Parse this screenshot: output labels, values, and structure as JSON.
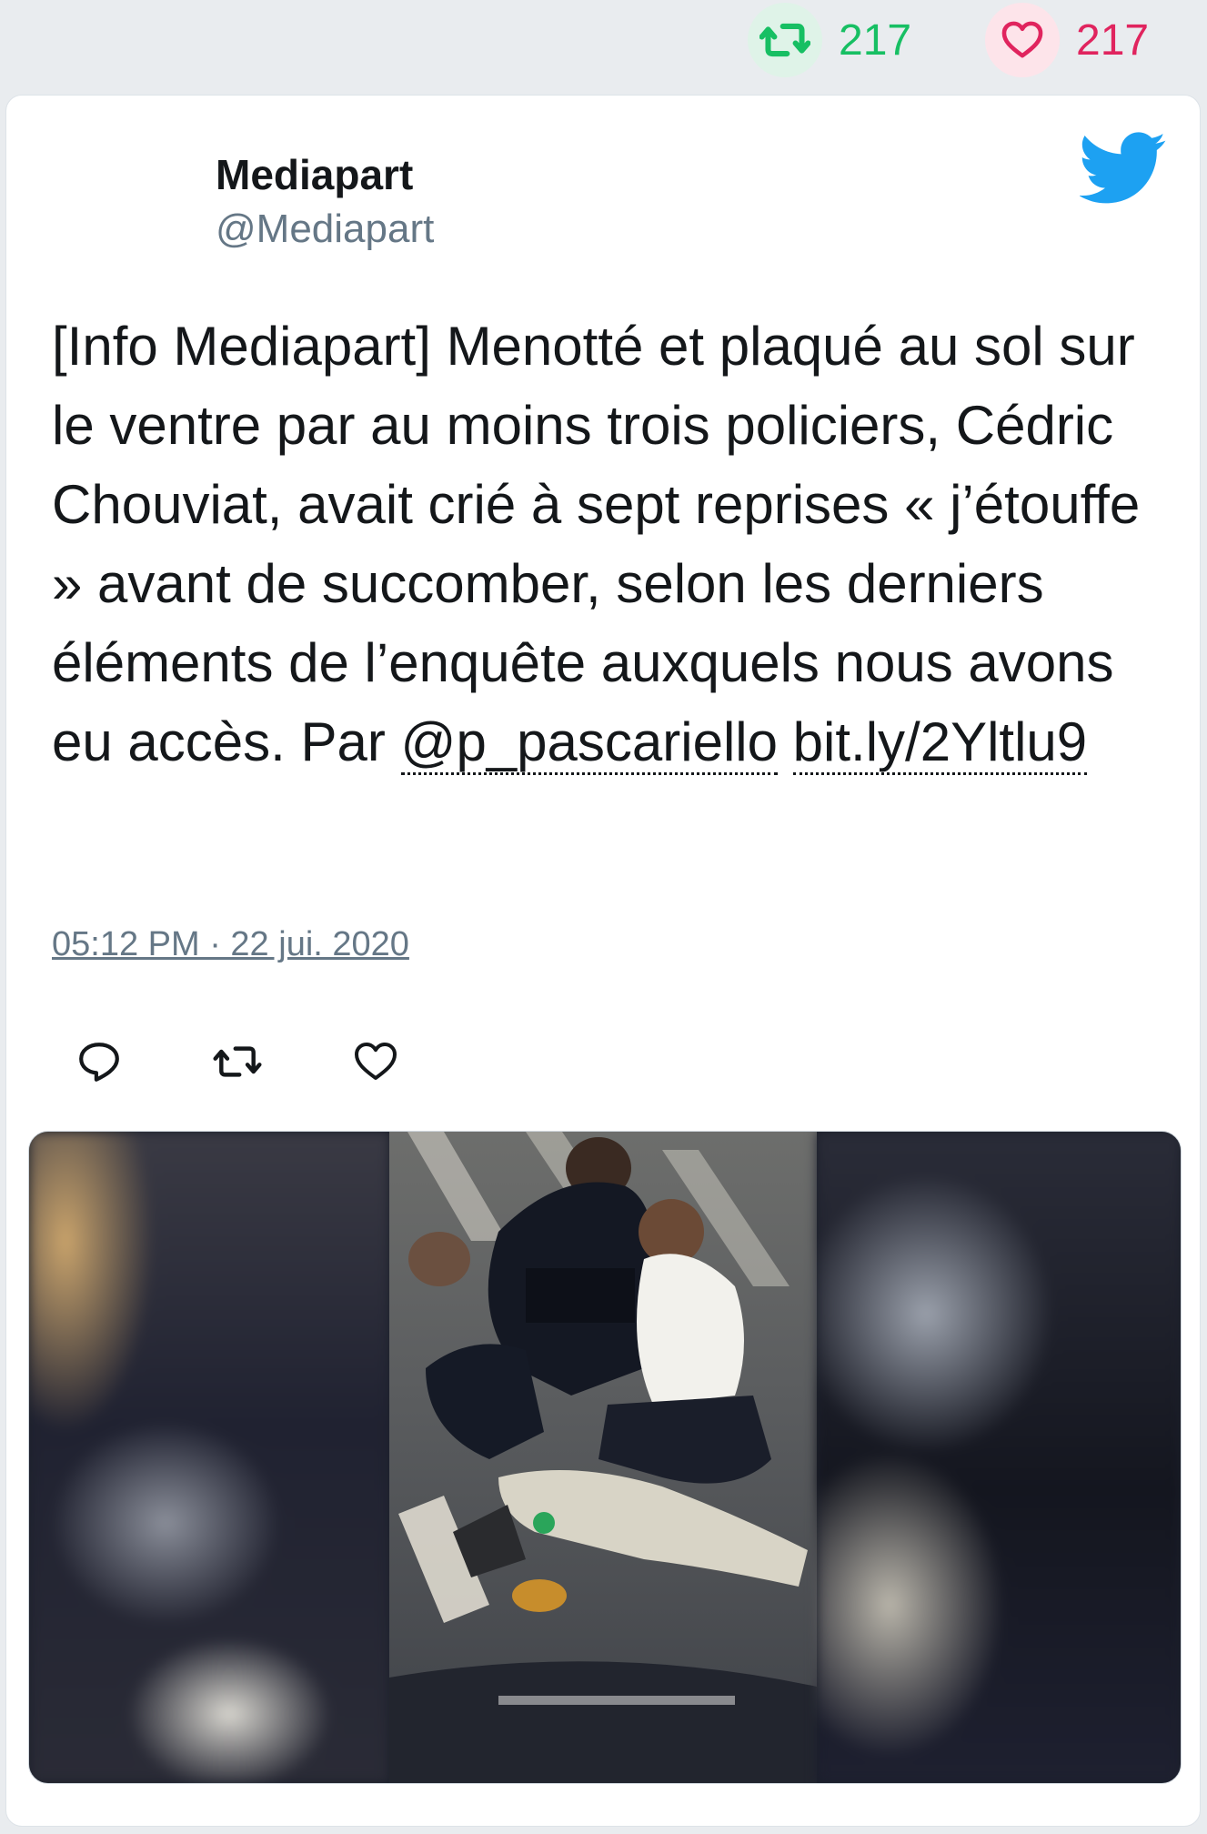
{
  "stats": {
    "retweets": "217",
    "likes": "217",
    "retweet_icon": "retweet-icon",
    "like_icon": "heart-icon",
    "retweet_color": "#17bf63",
    "like_color": "#e0245e"
  },
  "tweet": {
    "author_name": "Mediapart",
    "author_handle": "@Mediapart",
    "text_prefix": "[Info Mediapart] Menotté et plaqué au sol sur le ventre par au moins trois policiers, Cédric Chouviat, avait crié à sept reprises « j’étouffe » avant de succomber, selon les derniers éléments de l’enquête auxquels nous avons eu accès. Par ",
    "mention": "@p_pascariello",
    "link": "bit.ly/2Yltlu9",
    "timestamp": "05:12 PM · 22 jui. 2020",
    "brand_color": "#1da1f2",
    "bird_icon": "twitter-bird-icon"
  },
  "actions": {
    "reply_icon": "reply-icon",
    "retweet_icon": "retweet-icon",
    "like_icon": "heart-icon"
  },
  "media": {
    "description_icon": "photo"
  }
}
